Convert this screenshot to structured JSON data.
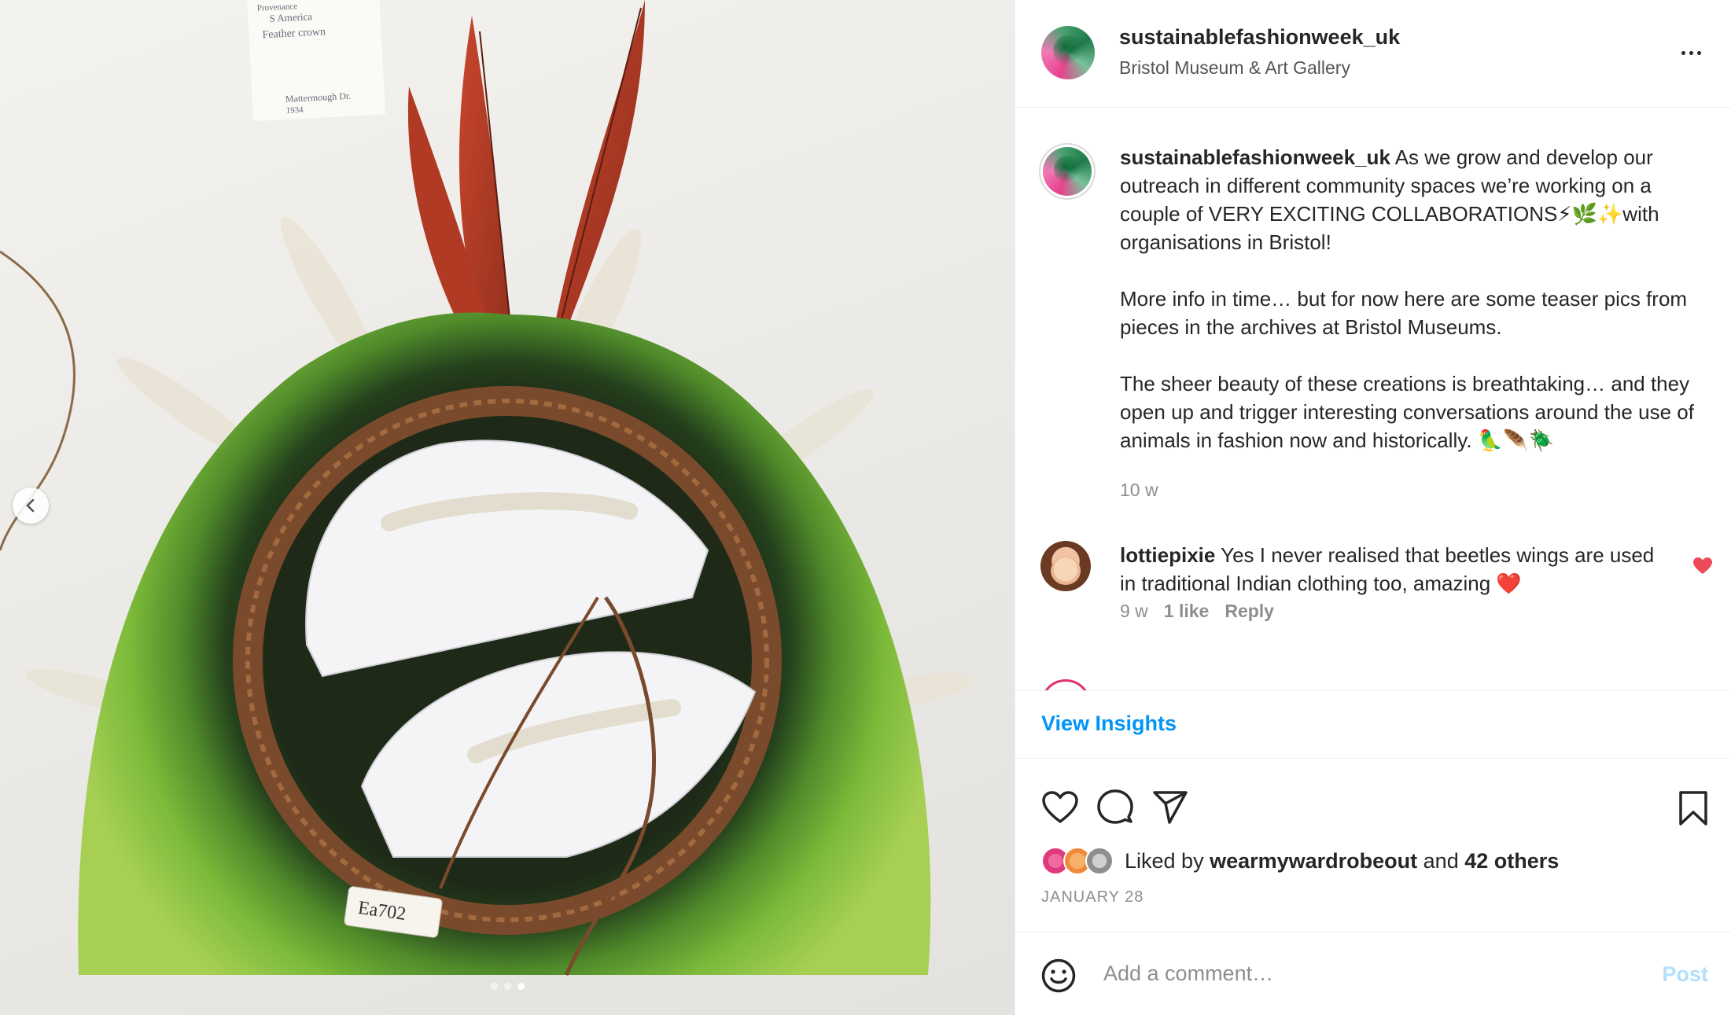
{
  "media": {
    "label_card_lines": [
      "Provenance",
      "S America",
      "Feather crown",
      "Mattermough Dr.",
      "1934"
    ],
    "tag_text": "Ea702",
    "slide_count": 3,
    "active_slide": 3
  },
  "header": {
    "username": "sustainablefashionweek_uk",
    "location": "Bristol Museum & Art Gallery"
  },
  "caption": {
    "username": "sustainablefashionweek_uk",
    "paragraph1": " As we grow and develop our outreach in different community spaces we’re working on a couple of VERY EXCITING COLLABORATIONS⚡🌿✨with organisations in Bristol!",
    "paragraph2": "More info in time… but for now here are some teaser pics from pieces in the archives at Bristol Museums.",
    "paragraph3": "The sheer beauty of these creations is breathtaking… and they open up and trigger interesting conversations around the use of animals in fashion now and historically. 🦜🪶🪲",
    "time": "10 w"
  },
  "comment": {
    "username": "lottiepixie",
    "text": " Yes I never realised that beetles wings are used in traditional Indian clothing too, amazing ❤️",
    "time": "9 w",
    "likes": "1 like",
    "reply": "Reply"
  },
  "insights_label": "View Insights",
  "likes": {
    "prefix": "Liked by ",
    "user": "wearmywardrobeout",
    "middle": " and ",
    "others": "42 others"
  },
  "date": "JANUARY 28",
  "add_comment": {
    "placeholder": "Add a comment…",
    "post_label": "Post"
  },
  "colors": {
    "link_blue": "#0095f6",
    "post_disabled": "#b2dffc",
    "like_red": "#ed4956"
  },
  "icons": [
    "chevron-left-icon",
    "more-icon",
    "heart-icon",
    "comment-icon",
    "share-icon",
    "bookmark-icon",
    "emoji-icon"
  ]
}
